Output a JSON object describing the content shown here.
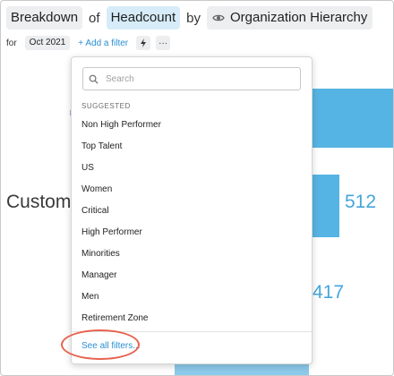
{
  "header": {
    "breakdown_label": "Breakdown",
    "of_label": "of",
    "metric": "Headcount",
    "by_label": "by",
    "hierarchy": "Organization Hierarchy"
  },
  "filters": {
    "for_label": "for",
    "period": "Oct 2021",
    "add_filter_label": "+ Add a filter",
    "more_label": "···"
  },
  "chart": {
    "category_label": "Custom",
    "values": [
      "512",
      "417"
    ]
  },
  "dropdown": {
    "search_placeholder": "Search",
    "section_label": "SUGGESTED",
    "options": [
      "Non High Performer",
      "Top Talent",
      "US",
      "Women",
      "Critical",
      "High Performer",
      "Minorities",
      "Manager",
      "Men",
      "Retirement Zone"
    ],
    "see_all_label": "See all filters..."
  },
  "colors": {
    "accent": "#2a8fd3",
    "bar": "#56b4e4",
    "highlight": "#e8624f",
    "metric_pill": "#d6ecf8"
  }
}
